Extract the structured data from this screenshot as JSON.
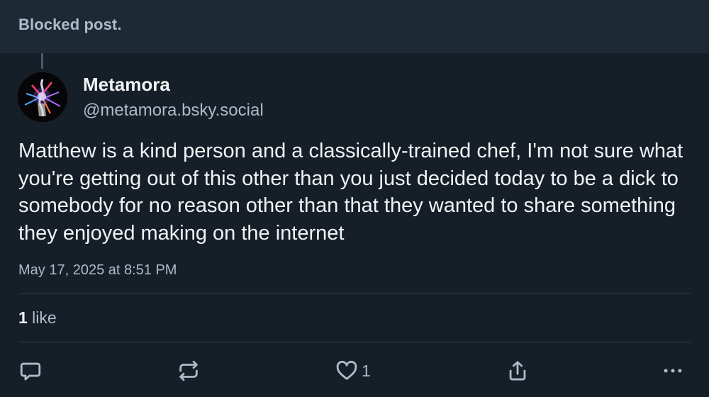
{
  "notice": {
    "text": "Blocked post."
  },
  "post": {
    "author": {
      "display_name": "Metamora",
      "handle": "@metamora.bsky.social",
      "avatar_icon": "abstract-colorful-avatar"
    },
    "text": "Matthew is a kind person and a classically-trained chef, I'm not sure what you're getting out of this other than you just decided today to be a dick to somebody for no reason other than that they wanted to share something they enjoyed making on the internet",
    "timestamp": "May 17, 2025 at 8:51 PM",
    "stats": {
      "likes_count": "1",
      "likes_label": " like"
    },
    "actions": {
      "reply_icon": "speech-bubble-icon",
      "repost_icon": "repost-arrows-icon",
      "like_icon": "heart-icon",
      "like_count": "1",
      "share_icon": "share-upload-icon",
      "more_icon": "ellipsis-icon"
    }
  },
  "colors": {
    "background": "#161e27",
    "notice_background": "#1e2936",
    "primary_text": "#f1f3f5",
    "secondary_text": "#aebbc9",
    "divider": "#2e3c4b"
  }
}
